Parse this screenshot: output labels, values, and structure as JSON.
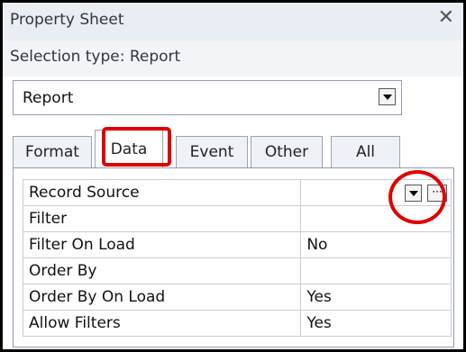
{
  "panel": {
    "title": "Property Sheet",
    "close_glyph": "✕",
    "selection_label": "Selection type:  Report"
  },
  "object_dropdown": {
    "value": "Report"
  },
  "tabs": [
    {
      "label": "Format",
      "active": false
    },
    {
      "label": "Data",
      "active": true
    },
    {
      "label": "Event",
      "active": false
    },
    {
      "label": "Other",
      "active": false
    },
    {
      "label": "All",
      "active": false
    }
  ],
  "properties": [
    {
      "name": "Record Source",
      "value": ""
    },
    {
      "name": "Filter",
      "value": ""
    },
    {
      "name": "Filter On Load",
      "value": "No"
    },
    {
      "name": "Order By",
      "value": ""
    },
    {
      "name": "Order By On Load",
      "value": "Yes"
    },
    {
      "name": "Allow Filters",
      "value": "Yes"
    }
  ],
  "record_source_controls": {
    "dropdown_icon": "chevron-down-icon",
    "builder_glyph": "···"
  },
  "colors": {
    "highlight": "#e00000",
    "header_bg": "#e9edf4"
  }
}
